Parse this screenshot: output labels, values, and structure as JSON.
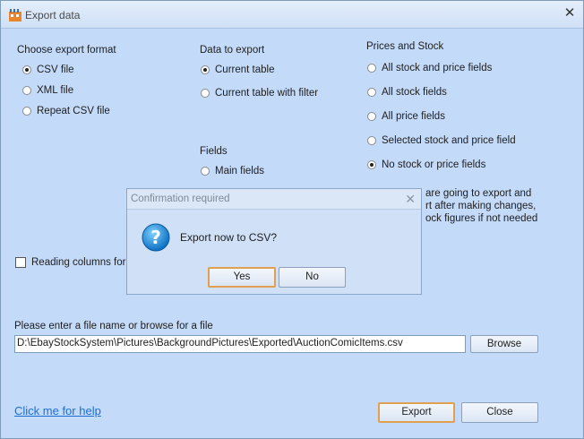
{
  "window": {
    "title": "Export data"
  },
  "format": {
    "heading": "Choose export format",
    "options": [
      {
        "label": "CSV file",
        "checked": true
      },
      {
        "label": "XML file",
        "checked": false
      },
      {
        "label": "Repeat CSV file",
        "checked": false
      }
    ]
  },
  "data_to_export": {
    "heading": "Data to export",
    "options": [
      {
        "label": "Current table",
        "checked": true
      },
      {
        "label": "Current table with filter",
        "checked": false
      }
    ]
  },
  "fields": {
    "heading": "Fields",
    "options": [
      {
        "label": "Main fields",
        "checked": false
      }
    ]
  },
  "prices": {
    "heading": "Prices and Stock",
    "options": [
      {
        "label": "All stock and price fields",
        "checked": false
      },
      {
        "label": "All stock fields",
        "checked": false
      },
      {
        "label": "All price fields",
        "checked": false
      },
      {
        "label": "Selected stock and price field",
        "checked": false
      },
      {
        "label": "No stock or price fields",
        "checked": true
      }
    ],
    "note_lines": [
      "are going to export and",
      "rt after making changes,",
      "ock figures if not needed"
    ]
  },
  "reading_columns": {
    "label": "Reading columns for",
    "checked": false
  },
  "file": {
    "label": "Please enter a file name or browse for a file",
    "value": "D:\\EbayStockSystem\\Pictures\\BackgroundPictures\\Exported\\AuctionComicItems.csv",
    "browse_label": "Browse"
  },
  "help_link": "Click me for help",
  "buttons": {
    "export": "Export",
    "close": "Close"
  },
  "dialog": {
    "title": "Confirmation required",
    "message": "Export now to CSV?",
    "yes": "Yes",
    "no": "No"
  }
}
